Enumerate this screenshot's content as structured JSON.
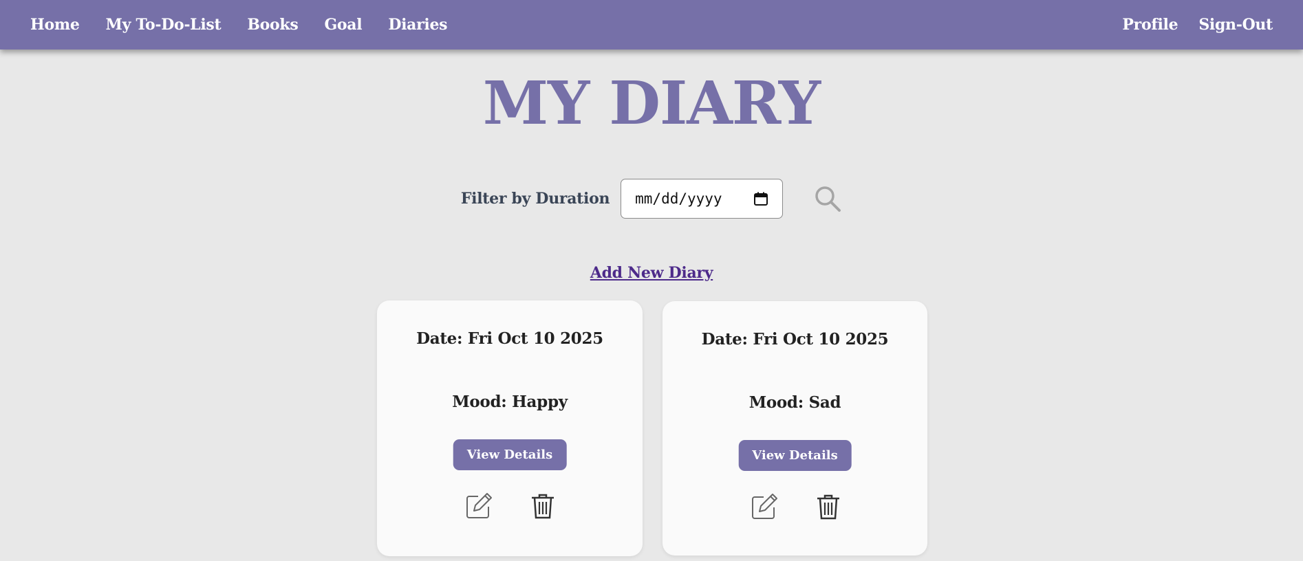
{
  "nav": {
    "left": [
      {
        "label": "Home"
      },
      {
        "label": "My To-Do-List"
      },
      {
        "label": "Books"
      },
      {
        "label": "Goal"
      },
      {
        "label": "Diaries"
      }
    ],
    "right": [
      {
        "label": "Profile"
      },
      {
        "label": "Sign-Out"
      }
    ]
  },
  "page": {
    "title": "MY DIARY",
    "filter_label": "Filter by Duration",
    "date_placeholder": "mm/dd/yyyy",
    "add_link": "Add New Diary"
  },
  "entries": [
    {
      "date": "Date: Fri Oct 10 2025",
      "mood": "Mood: Happy",
      "view_label": "View Details"
    },
    {
      "date": "Date: Fri Oct 10 2025",
      "mood": "Mood: Sad",
      "view_label": "View Details"
    }
  ],
  "icons": {
    "search": "search-icon",
    "calendar": "calendar-icon",
    "edit": "edit-icon",
    "delete": "trash-icon"
  },
  "colors": {
    "brand": "#7670a8",
    "background": "#e8e8e8",
    "card": "#fafafa",
    "link": "#4d2a8a"
  }
}
